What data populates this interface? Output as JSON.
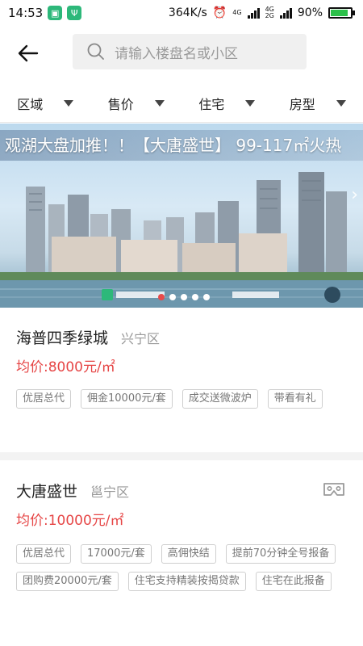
{
  "status_bar": {
    "time": "14:53",
    "net_speed": "364K/s",
    "net_type1": "4G",
    "net_type2": "4G",
    "net_type3": "2G",
    "battery": "90%"
  },
  "header": {
    "back_icon": "arrow-left-icon",
    "search_placeholder": "请输入楼盘名或小区"
  },
  "filters": [
    "区域",
    "售价",
    "住宅",
    "房型"
  ],
  "banner": {
    "title": "观湖大盘加推！！【大唐盛世】 99-117㎡火热",
    "slide_count": 6,
    "active_slide": 3
  },
  "listings": [
    {
      "name": "海普四季绿城",
      "district": "兴宁区",
      "price": "均价:8000元/㎡",
      "tags": [
        "优居总代",
        "佣金10000元/套",
        "成交送微波炉",
        "带看有礼"
      ]
    },
    {
      "name": "大唐盛世",
      "district": "邕宁区",
      "price": "均价:10000元/㎡",
      "tags": [
        "优居总代",
        "17000元/套",
        "高佣快结",
        "提前70分钟全号报备",
        "团购费20000元/套",
        "住宅支持精装按揭贷款",
        "住宅在此报备"
      ]
    }
  ],
  "colors": {
    "price": "#e64646",
    "accent_green": "#2db87a"
  }
}
